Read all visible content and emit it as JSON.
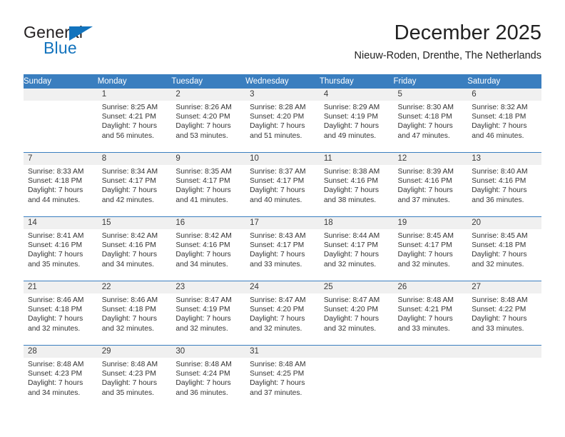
{
  "brand": {
    "name_part1": "General",
    "name_part2": "Blue",
    "triangle_color": "#1273bd",
    "text_color": "#231f20"
  },
  "header": {
    "month_title": "December 2025",
    "location": "Nieuw-Roden, Drenthe, The Netherlands"
  },
  "theme": {
    "header_blue": "#3a7ebf",
    "daynum_band": "#f0f0f0",
    "cell_background": "#ffffff",
    "text": "#333333"
  },
  "weekdays": [
    "Sunday",
    "Monday",
    "Tuesday",
    "Wednesday",
    "Thursday",
    "Friday",
    "Saturday"
  ],
  "weeks": [
    [
      {
        "day": "",
        "sunrise": "",
        "sunset": "",
        "daylight1": "",
        "daylight2": ""
      },
      {
        "day": "1",
        "sunrise": "Sunrise: 8:25 AM",
        "sunset": "Sunset: 4:21 PM",
        "daylight1": "Daylight: 7 hours",
        "daylight2": "and 56 minutes."
      },
      {
        "day": "2",
        "sunrise": "Sunrise: 8:26 AM",
        "sunset": "Sunset: 4:20 PM",
        "daylight1": "Daylight: 7 hours",
        "daylight2": "and 53 minutes."
      },
      {
        "day": "3",
        "sunrise": "Sunrise: 8:28 AM",
        "sunset": "Sunset: 4:20 PM",
        "daylight1": "Daylight: 7 hours",
        "daylight2": "and 51 minutes."
      },
      {
        "day": "4",
        "sunrise": "Sunrise: 8:29 AM",
        "sunset": "Sunset: 4:19 PM",
        "daylight1": "Daylight: 7 hours",
        "daylight2": "and 49 minutes."
      },
      {
        "day": "5",
        "sunrise": "Sunrise: 8:30 AM",
        "sunset": "Sunset: 4:18 PM",
        "daylight1": "Daylight: 7 hours",
        "daylight2": "and 47 minutes."
      },
      {
        "day": "6",
        "sunrise": "Sunrise: 8:32 AM",
        "sunset": "Sunset: 4:18 PM",
        "daylight1": "Daylight: 7 hours",
        "daylight2": "and 46 minutes."
      }
    ],
    [
      {
        "day": "7",
        "sunrise": "Sunrise: 8:33 AM",
        "sunset": "Sunset: 4:18 PM",
        "daylight1": "Daylight: 7 hours",
        "daylight2": "and 44 minutes."
      },
      {
        "day": "8",
        "sunrise": "Sunrise: 8:34 AM",
        "sunset": "Sunset: 4:17 PM",
        "daylight1": "Daylight: 7 hours",
        "daylight2": "and 42 minutes."
      },
      {
        "day": "9",
        "sunrise": "Sunrise: 8:35 AM",
        "sunset": "Sunset: 4:17 PM",
        "daylight1": "Daylight: 7 hours",
        "daylight2": "and 41 minutes."
      },
      {
        "day": "10",
        "sunrise": "Sunrise: 8:37 AM",
        "sunset": "Sunset: 4:17 PM",
        "daylight1": "Daylight: 7 hours",
        "daylight2": "and 40 minutes."
      },
      {
        "day": "11",
        "sunrise": "Sunrise: 8:38 AM",
        "sunset": "Sunset: 4:16 PM",
        "daylight1": "Daylight: 7 hours",
        "daylight2": "and 38 minutes."
      },
      {
        "day": "12",
        "sunrise": "Sunrise: 8:39 AM",
        "sunset": "Sunset: 4:16 PM",
        "daylight1": "Daylight: 7 hours",
        "daylight2": "and 37 minutes."
      },
      {
        "day": "13",
        "sunrise": "Sunrise: 8:40 AM",
        "sunset": "Sunset: 4:16 PM",
        "daylight1": "Daylight: 7 hours",
        "daylight2": "and 36 minutes."
      }
    ],
    [
      {
        "day": "14",
        "sunrise": "Sunrise: 8:41 AM",
        "sunset": "Sunset: 4:16 PM",
        "daylight1": "Daylight: 7 hours",
        "daylight2": "and 35 minutes."
      },
      {
        "day": "15",
        "sunrise": "Sunrise: 8:42 AM",
        "sunset": "Sunset: 4:16 PM",
        "daylight1": "Daylight: 7 hours",
        "daylight2": "and 34 minutes."
      },
      {
        "day": "16",
        "sunrise": "Sunrise: 8:42 AM",
        "sunset": "Sunset: 4:16 PM",
        "daylight1": "Daylight: 7 hours",
        "daylight2": "and 34 minutes."
      },
      {
        "day": "17",
        "sunrise": "Sunrise: 8:43 AM",
        "sunset": "Sunset: 4:17 PM",
        "daylight1": "Daylight: 7 hours",
        "daylight2": "and 33 minutes."
      },
      {
        "day": "18",
        "sunrise": "Sunrise: 8:44 AM",
        "sunset": "Sunset: 4:17 PM",
        "daylight1": "Daylight: 7 hours",
        "daylight2": "and 32 minutes."
      },
      {
        "day": "19",
        "sunrise": "Sunrise: 8:45 AM",
        "sunset": "Sunset: 4:17 PM",
        "daylight1": "Daylight: 7 hours",
        "daylight2": "and 32 minutes."
      },
      {
        "day": "20",
        "sunrise": "Sunrise: 8:45 AM",
        "sunset": "Sunset: 4:18 PM",
        "daylight1": "Daylight: 7 hours",
        "daylight2": "and 32 minutes."
      }
    ],
    [
      {
        "day": "21",
        "sunrise": "Sunrise: 8:46 AM",
        "sunset": "Sunset: 4:18 PM",
        "daylight1": "Daylight: 7 hours",
        "daylight2": "and 32 minutes."
      },
      {
        "day": "22",
        "sunrise": "Sunrise: 8:46 AM",
        "sunset": "Sunset: 4:18 PM",
        "daylight1": "Daylight: 7 hours",
        "daylight2": "and 32 minutes."
      },
      {
        "day": "23",
        "sunrise": "Sunrise: 8:47 AM",
        "sunset": "Sunset: 4:19 PM",
        "daylight1": "Daylight: 7 hours",
        "daylight2": "and 32 minutes."
      },
      {
        "day": "24",
        "sunrise": "Sunrise: 8:47 AM",
        "sunset": "Sunset: 4:20 PM",
        "daylight1": "Daylight: 7 hours",
        "daylight2": "and 32 minutes."
      },
      {
        "day": "25",
        "sunrise": "Sunrise: 8:47 AM",
        "sunset": "Sunset: 4:20 PM",
        "daylight1": "Daylight: 7 hours",
        "daylight2": "and 32 minutes."
      },
      {
        "day": "26",
        "sunrise": "Sunrise: 8:48 AM",
        "sunset": "Sunset: 4:21 PM",
        "daylight1": "Daylight: 7 hours",
        "daylight2": "and 33 minutes."
      },
      {
        "day": "27",
        "sunrise": "Sunrise: 8:48 AM",
        "sunset": "Sunset: 4:22 PM",
        "daylight1": "Daylight: 7 hours",
        "daylight2": "and 33 minutes."
      }
    ],
    [
      {
        "day": "28",
        "sunrise": "Sunrise: 8:48 AM",
        "sunset": "Sunset: 4:23 PM",
        "daylight1": "Daylight: 7 hours",
        "daylight2": "and 34 minutes."
      },
      {
        "day": "29",
        "sunrise": "Sunrise: 8:48 AM",
        "sunset": "Sunset: 4:23 PM",
        "daylight1": "Daylight: 7 hours",
        "daylight2": "and 35 minutes."
      },
      {
        "day": "30",
        "sunrise": "Sunrise: 8:48 AM",
        "sunset": "Sunset: 4:24 PM",
        "daylight1": "Daylight: 7 hours",
        "daylight2": "and 36 minutes."
      },
      {
        "day": "31",
        "sunrise": "Sunrise: 8:48 AM",
        "sunset": "Sunset: 4:25 PM",
        "daylight1": "Daylight: 7 hours",
        "daylight2": "and 37 minutes."
      },
      {
        "day": "",
        "sunrise": "",
        "sunset": "",
        "daylight1": "",
        "daylight2": ""
      },
      {
        "day": "",
        "sunrise": "",
        "sunset": "",
        "daylight1": "",
        "daylight2": ""
      },
      {
        "day": "",
        "sunrise": "",
        "sunset": "",
        "daylight1": "",
        "daylight2": ""
      }
    ]
  ]
}
